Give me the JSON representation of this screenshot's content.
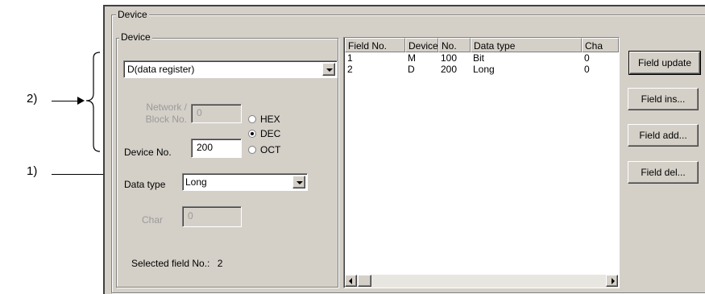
{
  "outer_group": {
    "title": "Device"
  },
  "device_group": {
    "title": "Device",
    "device_select": {
      "value": "D(data register)"
    },
    "network_block": {
      "label_line1": "Network /",
      "label_line2": "Block No.",
      "value": "0"
    },
    "device_no": {
      "label": "Device No.",
      "value": "200"
    },
    "radix_options": [
      {
        "label": "HEX",
        "selected": false
      },
      {
        "label": "DEC",
        "selected": true
      },
      {
        "label": "OCT",
        "selected": false
      }
    ],
    "data_type": {
      "label": "Data type",
      "value": "Long"
    },
    "char": {
      "label": "Char",
      "value": "0"
    },
    "selected_field": {
      "label": "Selected field No.:",
      "value": "2"
    }
  },
  "field_table": {
    "columns": [
      "Field No.",
      "Device",
      "No.",
      "Data type",
      "Cha"
    ],
    "rows": [
      [
        "1",
        "M",
        "100",
        "Bit",
        "0"
      ],
      [
        "2",
        "D",
        "200",
        "Long",
        "0"
      ]
    ],
    "selected_row": 0
  },
  "buttons": {
    "field_update": "Field update",
    "field_ins": "Field ins...",
    "field_add": "Field add...",
    "field_del": "Field del..."
  },
  "annotations": {
    "label_2": "2)",
    "label_1": "1)"
  }
}
